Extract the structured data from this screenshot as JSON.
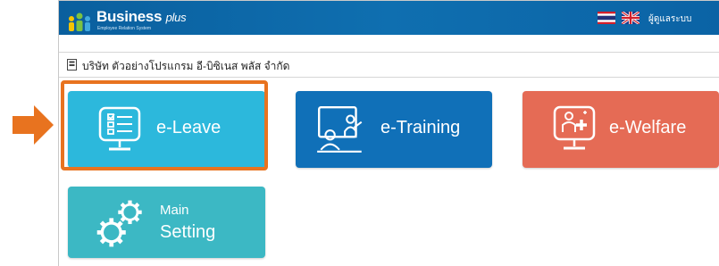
{
  "header": {
    "app_name": "Business",
    "app_name_suffix": "plus",
    "tagline": "Employee Relation System",
    "user_menu_label": "ผู้ดูแลระบบ",
    "background_color": "#0f6fb0"
  },
  "company": {
    "name": "บริษัท ตัวอย่างโปรแกรม อี-บิซิเนส พลัส จำกัด"
  },
  "modules": [
    {
      "label": "e-Leave",
      "icon": "leave-form-monitor-icon",
      "color": "#2cb8dc",
      "highlighted": true
    },
    {
      "label": "e-Training",
      "icon": "training-presentation-icon",
      "color": "#1070b8"
    },
    {
      "label": "e-Welfare",
      "icon": "welfare-plus-monitor-icon",
      "color": "#e56b55"
    },
    {
      "label_line1": "Main",
      "label_line2": "Setting",
      "icon": "gears-icon",
      "color": "#3cb8c4"
    }
  ],
  "annotation": {
    "highlight_color": "#e8731f",
    "arrow_color": "#e8731f"
  }
}
